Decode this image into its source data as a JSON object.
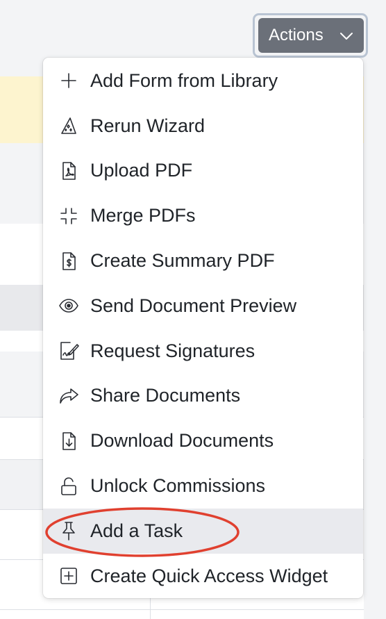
{
  "actions_button": {
    "label": "Actions",
    "icon": "chevron-down-icon"
  },
  "menu": {
    "items": [
      {
        "label": "Add Form from Library",
        "icon": "plus-icon"
      },
      {
        "label": "Rerun Wizard",
        "icon": "wizard-hat-icon"
      },
      {
        "label": "Upload PDF",
        "icon": "pdf-file-icon"
      },
      {
        "label": "Merge PDFs",
        "icon": "merge-arrows-icon"
      },
      {
        "label": "Create Summary PDF",
        "icon": "dollar-document-icon"
      },
      {
        "label": "Send Document Preview",
        "icon": "eye-icon"
      },
      {
        "label": "Request Signatures",
        "icon": "signature-icon"
      },
      {
        "label": "Share Documents",
        "icon": "share-arrow-icon"
      },
      {
        "label": "Download Documents",
        "icon": "download-document-icon"
      },
      {
        "label": "Unlock Commissions",
        "icon": "unlock-icon"
      },
      {
        "label": "Add a Task",
        "icon": "pushpin-icon",
        "highlighted": true
      },
      {
        "label": "Create Quick Access Widget",
        "icon": "plus-square-icon"
      }
    ]
  },
  "colors": {
    "actions_button_bg": "#6b7079",
    "highlight_bg": "#e9eaee",
    "annotation_red": "#e0402f",
    "banner_yellow": "#fdf4cf"
  }
}
